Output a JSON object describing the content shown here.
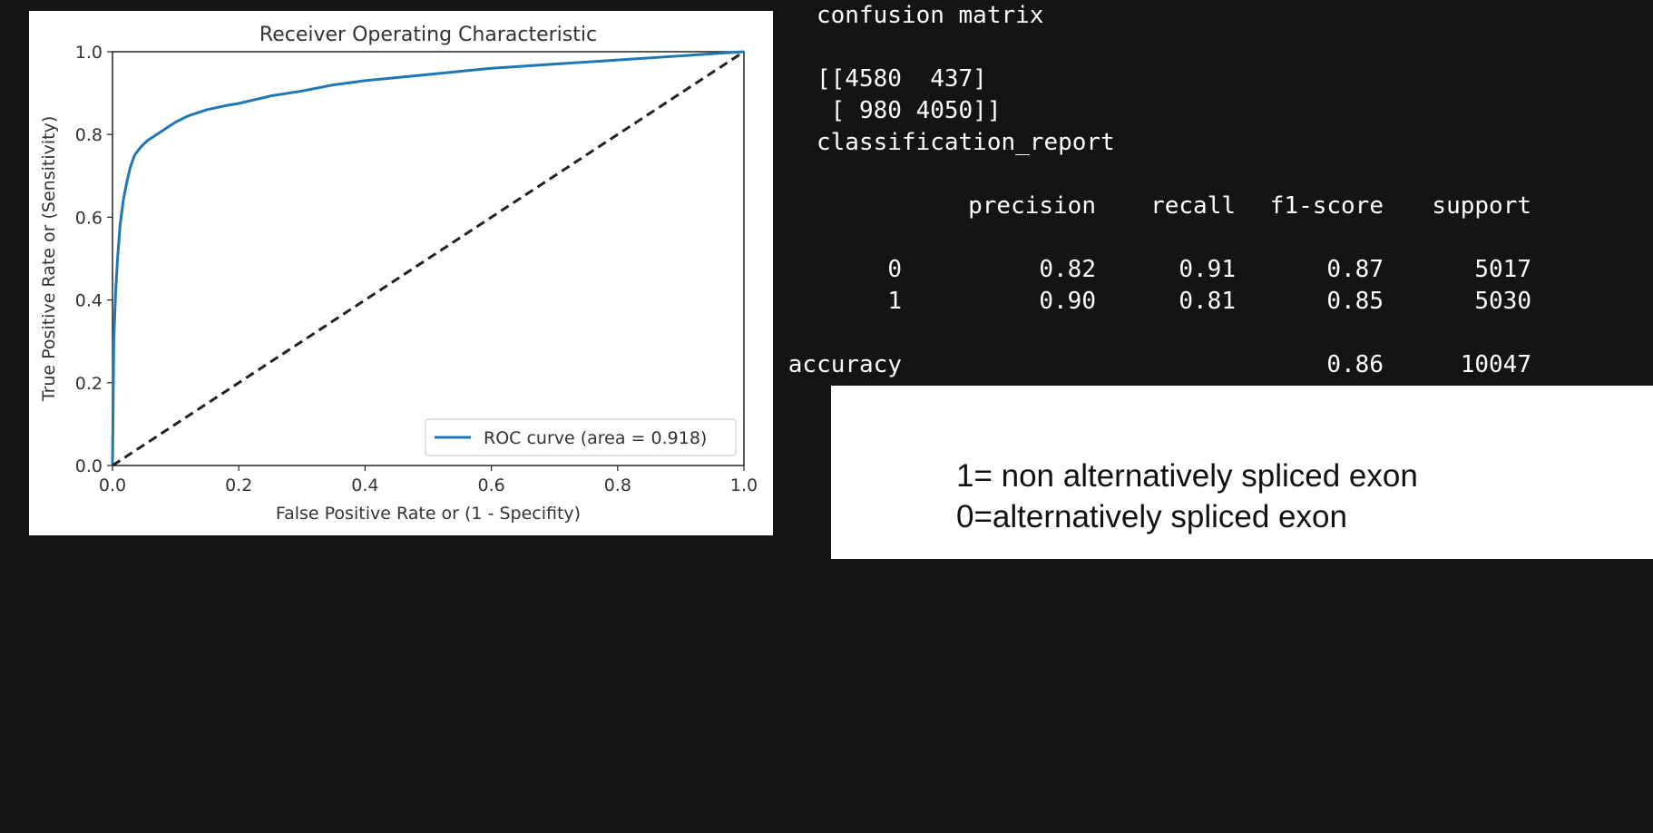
{
  "chart_data": {
    "type": "line",
    "title": "Receiver Operating Characteristic",
    "xlabel": "False Positive Rate or (1 - Specifity)",
    "ylabel": "True Positive Rate or (Sensitivity)",
    "xlim": [
      0.0,
      1.0
    ],
    "ylim": [
      0.0,
      1.0
    ],
    "xticks": [
      "0.0",
      "0.2",
      "0.4",
      "0.6",
      "0.8",
      "1.0"
    ],
    "yticks": [
      "0.0",
      "0.2",
      "0.4",
      "0.6",
      "0.8",
      "1.0"
    ],
    "grid": false,
    "legend_position": "lower-right",
    "series": [
      {
        "name": "ROC curve (area = 0.918)",
        "color": "#1f77b4",
        "style": "solid",
        "x": [
          0.0,
          0.002,
          0.005,
          0.008,
          0.012,
          0.017,
          0.022,
          0.028,
          0.035,
          0.045,
          0.055,
          0.07,
          0.085,
          0.1,
          0.12,
          0.15,
          0.18,
          0.2,
          0.25,
          0.3,
          0.35,
          0.4,
          0.5,
          0.6,
          0.7,
          0.8,
          0.9,
          0.95,
          1.0
        ],
        "y": [
          0.0,
          0.3,
          0.42,
          0.5,
          0.58,
          0.64,
          0.68,
          0.72,
          0.75,
          0.77,
          0.785,
          0.8,
          0.815,
          0.83,
          0.845,
          0.86,
          0.87,
          0.875,
          0.893,
          0.905,
          0.92,
          0.93,
          0.945,
          0.96,
          0.97,
          0.98,
          0.99,
          0.995,
          1.0
        ]
      },
      {
        "name": "",
        "color": "#222222",
        "style": "dashed",
        "x": [
          0.0,
          1.0
        ],
        "y": [
          0.0,
          1.0
        ]
      }
    ]
  },
  "console": {
    "title": "confusion matrix",
    "matrix_row1": "[[4580  437]",
    "matrix_row2": " [ 980 4050]]",
    "report_title": "classification_report",
    "headers": [
      "precision",
      "recall",
      "f1-score",
      "support"
    ],
    "rows": [
      {
        "label": "0",
        "values": [
          "0.82",
          "0.91",
          "0.87",
          "5017"
        ]
      },
      {
        "label": "1",
        "values": [
          "0.90",
          "0.81",
          "0.85",
          "5030"
        ]
      }
    ],
    "accuracy": {
      "label": "accuracy",
      "f1": "0.86",
      "support": "10047"
    }
  },
  "notes": {
    "line1": "1= non alternatively spliced exon",
    "line2": "0=alternatively spliced exon"
  }
}
